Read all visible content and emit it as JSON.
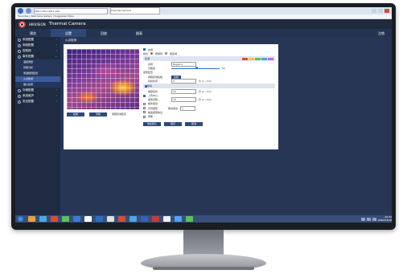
{
  "browser": {
    "address": "http://192.168.1.100",
    "tab_title": "Thermal Camera",
    "favorites": "Favorites  |  Web Slice Gallery  |  Suggested Sites"
  },
  "app": {
    "brand": "HIKVISION",
    "title": "Thermal Camera"
  },
  "topnav": {
    "items": [
      "预览",
      "设置",
      "回放",
      "图表"
    ],
    "active_index": 1,
    "logout": "注销"
  },
  "sidebar": {
    "items": [
      {
        "label": "系统配置"
      },
      {
        "label": "网络配置"
      },
      {
        "label": "视音频"
      },
      {
        "label": "事件配置"
      },
      {
        "label": "温度测量",
        "sub": true
      },
      {
        "label": "智能分析",
        "sub": true
      },
      {
        "label": "测温规则配置",
        "sub": true
      },
      {
        "label": "火点检测",
        "sub": true,
        "active": true
      },
      {
        "label": "烟火检测",
        "sub": true
      },
      {
        "label": "存储配置"
      },
      {
        "label": "系统维护"
      },
      {
        "label": "安全配置"
      }
    ]
  },
  "breadcrumb": "火点检测",
  "thermal": {
    "buttons": [
      "绘制",
      "清除"
    ],
    "link": "屏蔽区域配置"
  },
  "form": {
    "enable_label": "启用",
    "mode_label": "模式",
    "mode_options": [
      "按规则",
      "按区域"
    ],
    "region_section": "区域",
    "name_label": "名称",
    "name_value": "Region1",
    "sensitivity_label": "灵敏度",
    "sensitivity_value": "50",
    "alarm_label": "报警配置",
    "mask_label": "屏蔽区域绘制",
    "mask_button": "绘制",
    "duration_label": "持续时间",
    "duration_value": "5",
    "duration_unit": "秒 (0~300)",
    "checks": [
      {
        "label": "联动",
        "checked": true
      },
      {
        "label": "上传中心",
        "checked": true
      },
      {
        "label": "邮件联动",
        "checked": false
      },
      {
        "label": "声音报警",
        "checked": false
      },
      {
        "label": "触发报警输出",
        "checked": false
      },
      {
        "label": "录像",
        "checked": false
      }
    ],
    "delay_label": "报警延时",
    "delay_value": "10",
    "delay_unit": "秒 (0~300)",
    "interval_label": "报警间隔",
    "interval_value": "15",
    "interval_unit": "秒 (0~300)",
    "channel_label": "联动通道",
    "channel_value": "1",
    "buttons": [
      "恢复默认",
      "保存",
      "取消"
    ],
    "swatch_colors": [
      "#e24b3b",
      "#f5c542",
      "#5bc25b",
      "#4aa8e8",
      "#c66ae0"
    ]
  },
  "taskbar": {
    "time": "10:24",
    "date": "2020/03/18",
    "icons": [
      "#e9a23b",
      "#4aa8e8",
      "#d94c3a",
      "#5bc25b",
      "#3a7ad9",
      "#ffffff",
      "#2f6bc2",
      "#e0e0e0",
      "#d94c3a",
      "#4aa8e8",
      "#3a5fb8",
      "#c23a3a",
      "#f0f0f0",
      "#4fa3ff",
      "#5bc25b"
    ]
  }
}
